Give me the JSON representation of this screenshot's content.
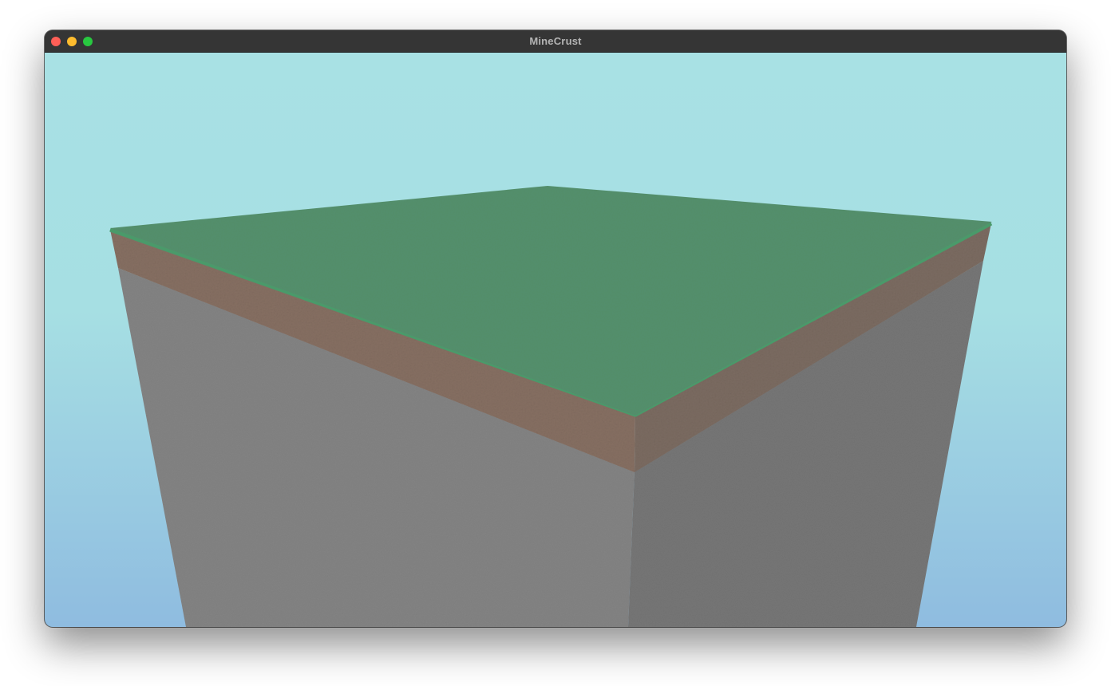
{
  "window": {
    "title": "MineCrust",
    "controls": {
      "close_color": "#ff5f57",
      "minimize_color": "#febc2e",
      "maximize_color": "#28c840"
    }
  },
  "scene": {
    "sky_top_color": "#a8e1e4",
    "sky_bottom_color": "#8fbce0",
    "grass_color": "#548f6c",
    "grass_edge_color": "#4a9a6a",
    "dirt_color": "#866f62",
    "stone_left_color": "#838383",
    "stone_right_color": "#767676",
    "blocks": [
      "grass-block-layer",
      "dirt-block-layer",
      "stone-block-layer"
    ]
  }
}
